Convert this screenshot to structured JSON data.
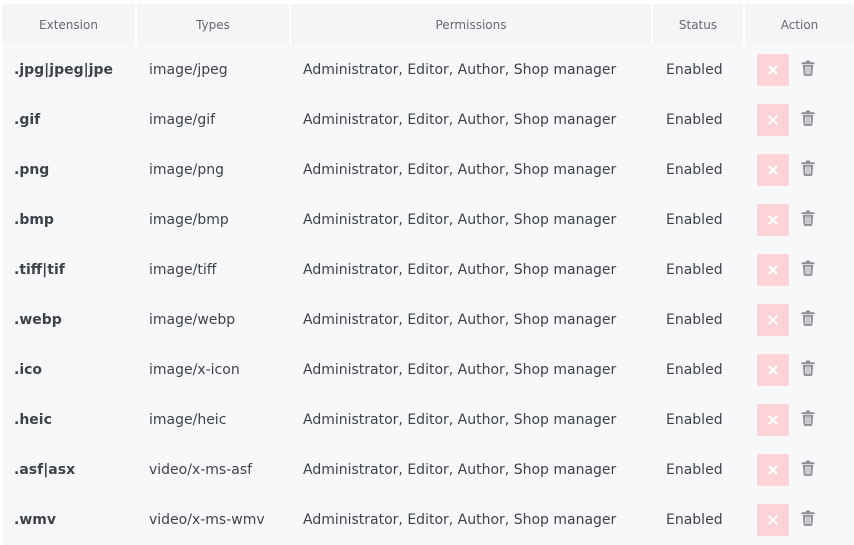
{
  "table": {
    "headers": {
      "extension": "Extension",
      "types": "Types",
      "permissions": "Permissions",
      "status": "Status",
      "action": "Action"
    },
    "rows": [
      {
        "extension": ".jpg|jpeg|jpe",
        "type": "image/jpeg",
        "permissions": "Administrator, Editor, Author, Shop manager",
        "status": "Enabled"
      },
      {
        "extension": ".gif",
        "type": "image/gif",
        "permissions": "Administrator, Editor, Author, Shop manager",
        "status": "Enabled"
      },
      {
        "extension": ".png",
        "type": "image/png",
        "permissions": "Administrator, Editor, Author, Shop manager",
        "status": "Enabled"
      },
      {
        "extension": ".bmp",
        "type": "image/bmp",
        "permissions": "Administrator, Editor, Author, Shop manager",
        "status": "Enabled"
      },
      {
        "extension": ".tiff|tif",
        "type": "image/tiff",
        "permissions": "Administrator, Editor, Author, Shop manager",
        "status": "Enabled"
      },
      {
        "extension": ".webp",
        "type": "image/webp",
        "permissions": "Administrator, Editor, Author, Shop manager",
        "status": "Enabled"
      },
      {
        "extension": ".ico",
        "type": "image/x-icon",
        "permissions": "Administrator, Editor, Author, Shop manager",
        "status": "Enabled"
      },
      {
        "extension": ".heic",
        "type": "image/heic",
        "permissions": "Administrator, Editor, Author, Shop manager",
        "status": "Enabled"
      },
      {
        "extension": ".asf|asx",
        "type": "video/x-ms-asf",
        "permissions": "Administrator, Editor, Author, Shop manager",
        "status": "Enabled"
      },
      {
        "extension": ".wmv",
        "type": "video/x-ms-wmv",
        "permissions": "Administrator, Editor, Author, Shop manager",
        "status": "Enabled"
      }
    ],
    "action_icons": {
      "disable": "close-icon",
      "delete": "trash-icon"
    },
    "colors": {
      "disable_button_bg": "#fdd3d7",
      "disable_icon": "#ffffff",
      "trash_icon": "#8c8f94",
      "row_bg": "#f8f8fa",
      "header_bg": "#f5f5f7"
    }
  }
}
